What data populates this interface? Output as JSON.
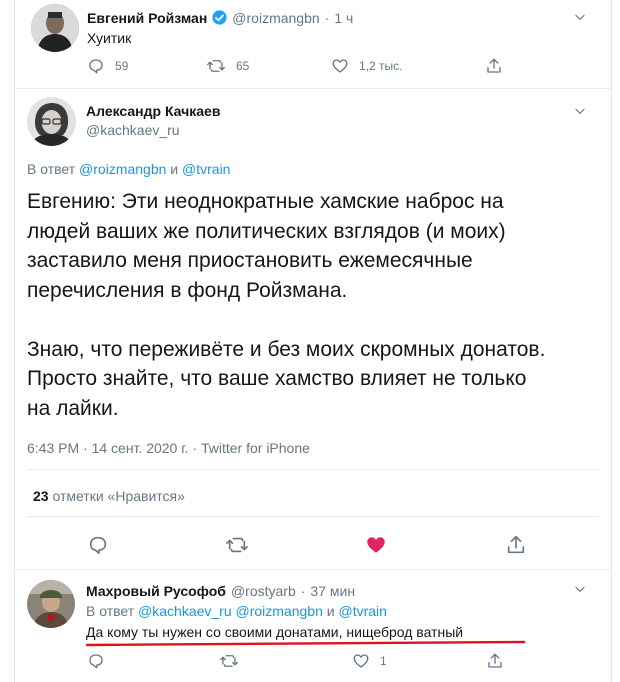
{
  "tweet1": {
    "name": "Евгений Ройзман",
    "handle": "@roizmangbn",
    "sep": "·",
    "time": "1 ч",
    "text": "Хуитик",
    "replies": "59",
    "retweets": "65",
    "likes": "1,2 тыс."
  },
  "tweet2": {
    "name": "Александр Качкаев",
    "handle": "@kachkaev_ru",
    "reply_prefix": "В ответ",
    "reply_to_1": "@roizmangbn",
    "reply_and": "и",
    "reply_to_2": "@tvrain",
    "body": [
      "Евгению: Эти неоднократные хамские наброс на",
      "людей ваших же политических взглядов (и моих)",
      "заставило меня приостановить ежемесячные",
      "перечисления в фонд Ройзмана.",
      "",
      "Знаю, что переживёте и без моих скромных донатов.",
      "Просто знайте, что ваше хамство влияет не только",
      "на лайки."
    ],
    "timestamp": "6:43 PM · 14 сент. 2020 г. ·",
    "source": "Twitter for iPhone",
    "likes_count": "23",
    "likes_label": "отметки «Нравится»"
  },
  "tweet3": {
    "name": "Махровый Русофоб",
    "handle": "@rostyarb",
    "sep": "·",
    "time": "37 мин",
    "reply_prefix": "В ответ",
    "reply_to_1": "@kachkaev_ru",
    "reply_to_2": "@roizmangbn",
    "reply_and": "и",
    "reply_to_3": "@tvrain",
    "text": "Да кому ты нужен со своими донатами, нищеброд ватный",
    "likes": "1"
  },
  "colors": {
    "verified": "#1da1f2",
    "link": "#1b95e0",
    "liked": "#e0245e",
    "underline": "#e0101f"
  }
}
